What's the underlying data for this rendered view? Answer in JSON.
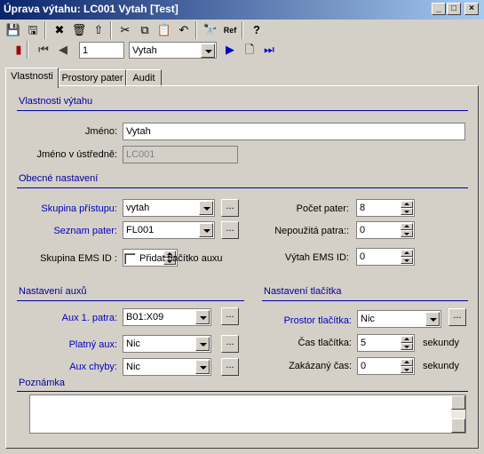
{
  "window": {
    "title": "Úprava výtahu: LC001 Vytah [Test]",
    "buttons": {
      "minimize": "_",
      "maximize": "□",
      "close": "×"
    }
  },
  "toolbar": {
    "row1": [
      {
        "name": "save-icon",
        "glyph": "💾"
      },
      {
        "name": "save-all-icon",
        "glyph": "🖫"
      },
      {
        "name": "delete-x-icon",
        "glyph": "✖"
      },
      {
        "name": "trash-icon",
        "glyph": "🗑"
      },
      {
        "name": "upload-icon",
        "glyph": "⇧"
      },
      {
        "name": "cut-icon",
        "glyph": "✂"
      },
      {
        "name": "copy-icon",
        "glyph": "⧉"
      },
      {
        "name": "paste-icon",
        "glyph": "📋"
      },
      {
        "name": "undo-icon",
        "glyph": "↶"
      },
      {
        "name": "find-icon",
        "glyph": "🔭"
      },
      {
        "name": "refresh-ref-icon",
        "glyph": "Ref"
      },
      {
        "name": "help-icon",
        "glyph": "?"
      }
    ],
    "nav": {
      "record_number": "1",
      "record_select": "Vytah"
    }
  },
  "tabs": [
    "Vlastnosti",
    "Prostory pater",
    "Audit"
  ],
  "sections": {
    "props": "Vlastnosti výtahu",
    "general": "Obecné nastavení",
    "aux": "Nastavení auxů",
    "button": "Nastavení tlačítka",
    "note": "Poznámka"
  },
  "fields": {
    "name_label": "Jméno:",
    "name_value": "Vytah",
    "central_name_label": "Jméno v ústředně:",
    "central_name_value": "LC001",
    "access_group_label": "Skupina přístupu:",
    "access_group_value": "vytah",
    "floor_list_label": "Seznam pater:",
    "floor_list_value": "FL001",
    "ems_group_label": "Skupina EMS ID :",
    "add_aux_label": "Přidat tlačítko auxu",
    "floor_count_label": "Počet pater:",
    "floor_count_value": "8",
    "unused_floors_label": "Nepoužitá patra::",
    "unused_floors_value": "0",
    "elevator_ems_label": "Výtah EMS ID:",
    "elevator_ems_value": "0",
    "aux1_label": "Aux 1. patra:",
    "aux1_value": "B01:X09",
    "valid_aux_label": "Platný aux:",
    "valid_aux_value": "Nic",
    "error_aux_label": "Aux chyby:",
    "error_aux_value": "Nic",
    "button_space_label": "Prostor tlačítka:",
    "button_space_value": "Nic",
    "button_time_label": "Čas tlačítka:",
    "button_time_value": "5",
    "blocked_time_label": "Zakázaný čas:",
    "blocked_time_value": "0",
    "seconds": "sekundy",
    "dots": "..."
  },
  "colors": {
    "accent": "#0000a0",
    "title_start": "#0a246a",
    "title_end": "#a6caf0"
  }
}
